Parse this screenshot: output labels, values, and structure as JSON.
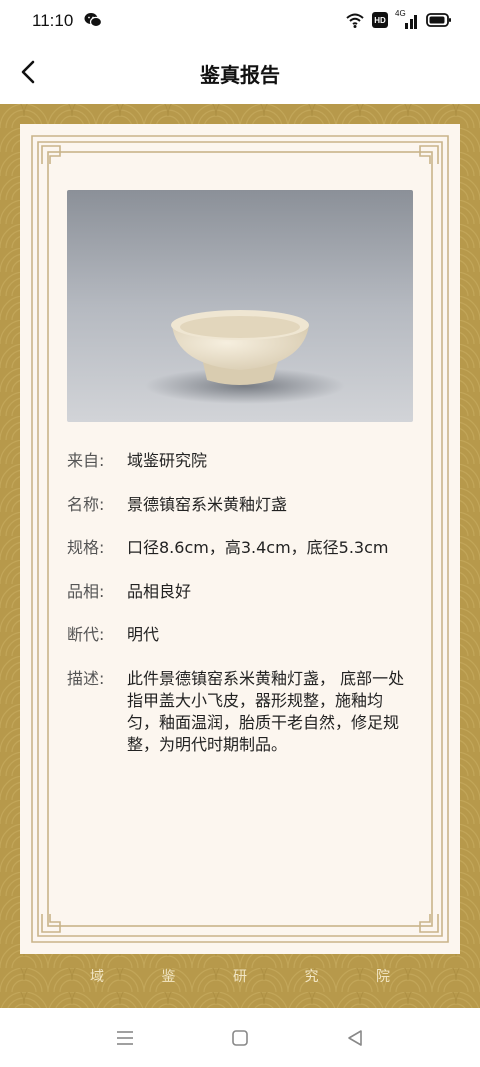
{
  "status_bar": {
    "time": "11:10",
    "icons": [
      "wechat-icon",
      "wifi-icon",
      "hd-icon",
      "4g-signal-icon",
      "battery-icon"
    ],
    "hd_label": "HD",
    "network_label": "4G"
  },
  "header": {
    "title": "鉴真报告",
    "back_icon": "chevron-left-icon"
  },
  "report": {
    "image_alt": "景德镇窑系米黄釉灯盏",
    "fields": [
      {
        "label": "来自:",
        "value": "域鉴研究院"
      },
      {
        "label": "名称:",
        "value": "景德镇窑系米黄釉灯盏"
      },
      {
        "label": "规格:",
        "value": "口径8.6cm，高3.4cm，底径5.3cm"
      },
      {
        "label": "品相:",
        "value": "品相良好"
      },
      {
        "label": "断代:",
        "value": "明代"
      },
      {
        "label": "描述:",
        "value": "此件景德镇窑系米黄釉灯盏， 底部一处指甲盖大小飞皮，器形规整，施釉均匀，釉面温润，胎质干老自然，修足规整，为明代时期制品。"
      }
    ]
  },
  "footer_brand": [
    "域",
    "鉴",
    "研",
    "究",
    "院"
  ],
  "colors": {
    "frame_gold": "#b7994b",
    "paper": "#fcf6ef",
    "border_line": "#c9b48a"
  },
  "nav_bar": {
    "icons": [
      "menu-icon",
      "home-square-icon",
      "back-triangle-icon"
    ]
  }
}
